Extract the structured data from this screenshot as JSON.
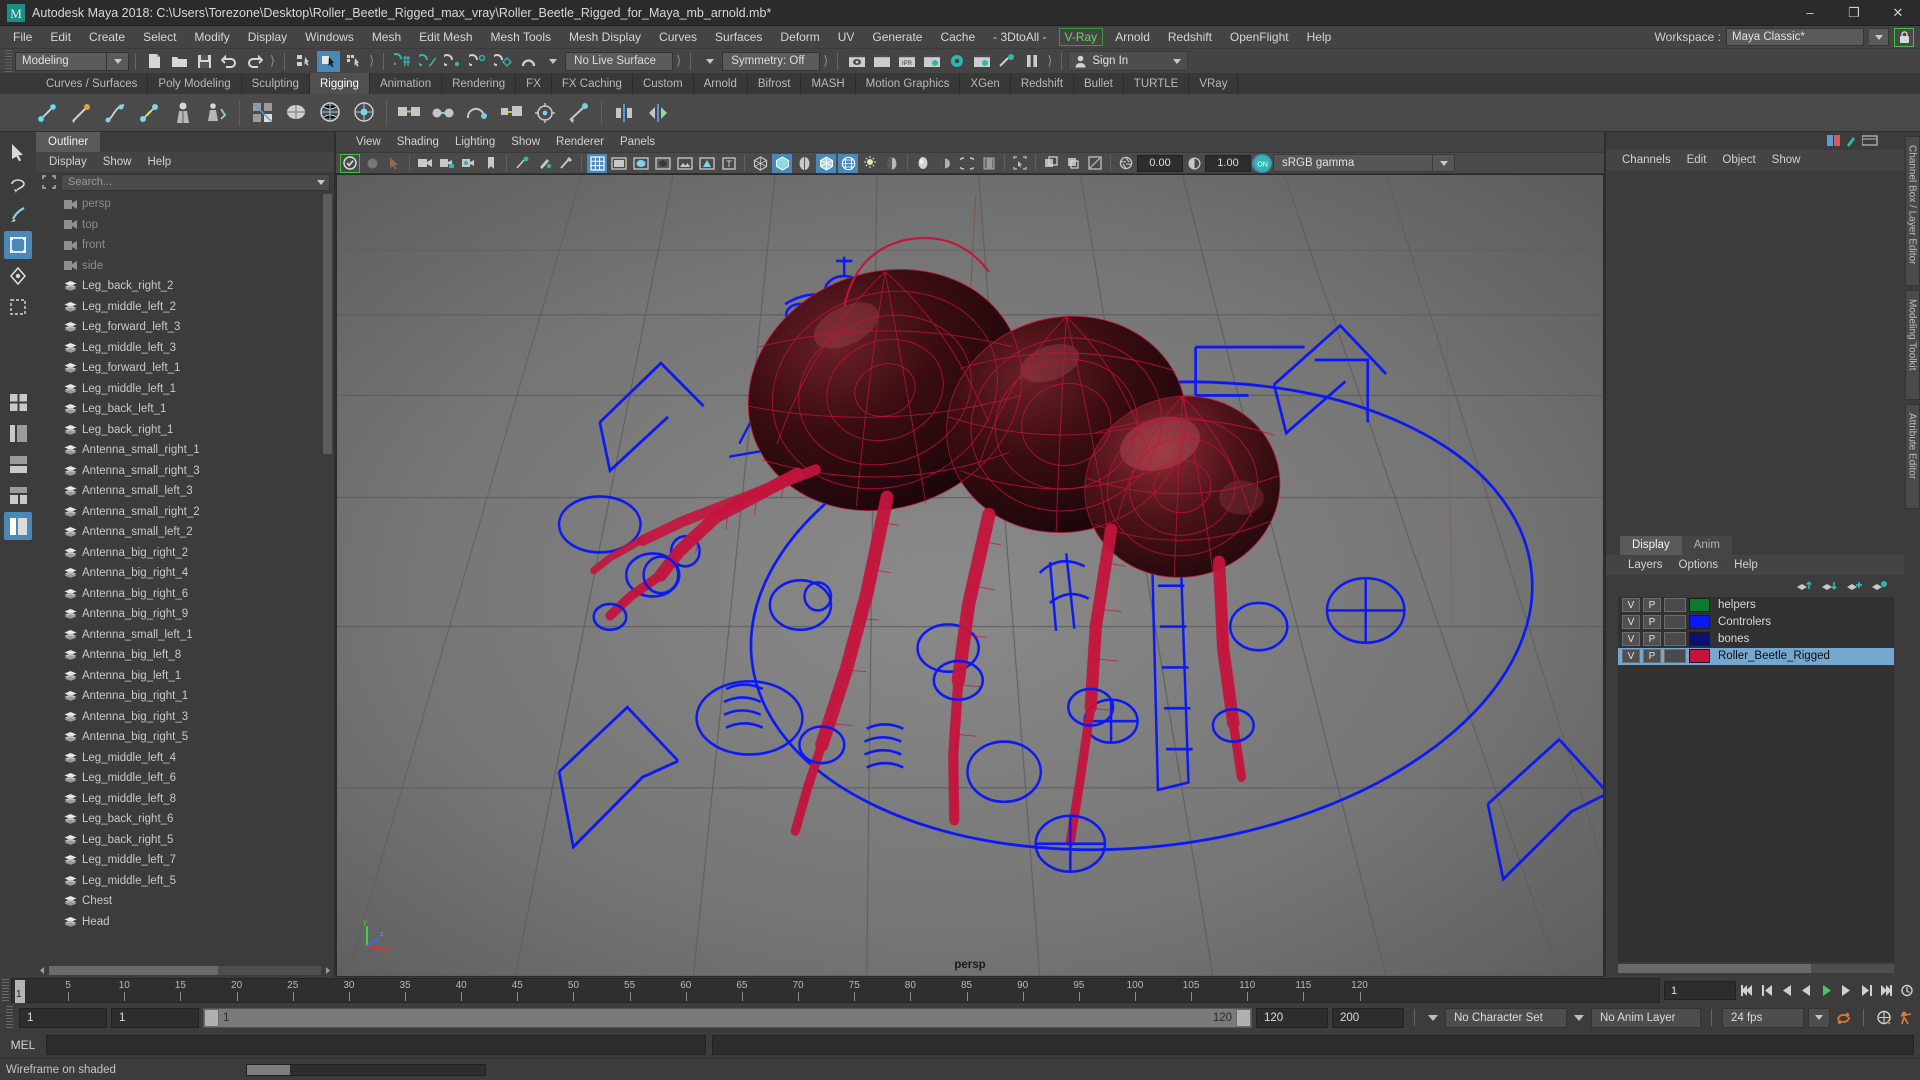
{
  "titlebar": {
    "title": "Autodesk Maya 2018: C:\\Users\\Torezone\\Desktop\\Roller_Beetle_Rigged_max_vray\\Roller_Beetle_Rigged_for_Maya_mb_arnold.mb*",
    "minimize": "–",
    "maximize": "❐",
    "close": "✕"
  },
  "menubar": {
    "items": [
      {
        "label": "File"
      },
      {
        "label": "Edit"
      },
      {
        "label": "Create"
      },
      {
        "label": "Select"
      },
      {
        "label": "Modify"
      },
      {
        "label": "Display"
      },
      {
        "label": "Windows"
      },
      {
        "label": "Mesh"
      },
      {
        "label": "Edit Mesh"
      },
      {
        "label": "Mesh Tools"
      },
      {
        "label": "Mesh Display"
      },
      {
        "label": "Curves"
      },
      {
        "label": "Surfaces"
      },
      {
        "label": "Deform"
      },
      {
        "label": "UV"
      },
      {
        "label": "Generate"
      },
      {
        "label": "Cache"
      },
      {
        "label": "- 3DtoAll -"
      },
      {
        "label": "V-Ray",
        "highlight": true
      },
      {
        "label": "Arnold"
      },
      {
        "label": "Redshift"
      },
      {
        "label": "OpenFlight"
      },
      {
        "label": "Help"
      }
    ],
    "workspace_label": "Workspace :",
    "workspace_value": "Maya Classic*",
    "lock_icon": "lock-icon"
  },
  "statusline": {
    "mode": "Modeling",
    "live_surface": "No Live Surface",
    "symmetry": "Symmetry: Off",
    "signin": "Sign In"
  },
  "shelf": {
    "tabs": [
      {
        "label": "Curves / Surfaces"
      },
      {
        "label": "Poly Modeling"
      },
      {
        "label": "Sculpting"
      },
      {
        "label": "Rigging",
        "active": true
      },
      {
        "label": "Animation"
      },
      {
        "label": "Rendering"
      },
      {
        "label": "FX"
      },
      {
        "label": "FX Caching"
      },
      {
        "label": "Custom"
      },
      {
        "label": "Arnold"
      },
      {
        "label": "Bifrost"
      },
      {
        "label": "MASH"
      },
      {
        "label": "Motion Graphics"
      },
      {
        "label": "XGen"
      },
      {
        "label": "Redshift"
      },
      {
        "label": "Bullet"
      },
      {
        "label": "TURTLE"
      },
      {
        "label": "VRay"
      }
    ]
  },
  "outliner": {
    "tab": "Outliner",
    "menus": [
      "Display",
      "Show",
      "Help"
    ],
    "search_placeholder": "Search...",
    "items": [
      {
        "label": "persp",
        "icon": "camera-icon",
        "dim": true
      },
      {
        "label": "top",
        "icon": "camera-icon",
        "dim": true
      },
      {
        "label": "front",
        "icon": "camera-icon",
        "dim": true
      },
      {
        "label": "side",
        "icon": "camera-icon",
        "dim": true
      },
      {
        "label": "Leg_back_right_2",
        "icon": "mesh-icon"
      },
      {
        "label": "Leg_middle_left_2",
        "icon": "mesh-icon"
      },
      {
        "label": "Leg_forward_left_3",
        "icon": "mesh-icon"
      },
      {
        "label": "Leg_middle_left_3",
        "icon": "mesh-icon"
      },
      {
        "label": "Leg_forward_left_1",
        "icon": "mesh-icon"
      },
      {
        "label": "Leg_middle_left_1",
        "icon": "mesh-icon"
      },
      {
        "label": "Leg_back_left_1",
        "icon": "mesh-icon"
      },
      {
        "label": "Leg_back_right_1",
        "icon": "mesh-icon"
      },
      {
        "label": "Antenna_small_right_1",
        "icon": "mesh-icon"
      },
      {
        "label": "Antenna_small_right_3",
        "icon": "mesh-icon"
      },
      {
        "label": "Antenna_small_left_3",
        "icon": "mesh-icon"
      },
      {
        "label": "Antenna_small_right_2",
        "icon": "mesh-icon"
      },
      {
        "label": "Antenna_small_left_2",
        "icon": "mesh-icon"
      },
      {
        "label": "Antenna_big_right_2",
        "icon": "mesh-icon"
      },
      {
        "label": "Antenna_big_right_4",
        "icon": "mesh-icon"
      },
      {
        "label": "Antenna_big_right_6",
        "icon": "mesh-icon"
      },
      {
        "label": "Antenna_big_right_9",
        "icon": "mesh-icon"
      },
      {
        "label": "Antenna_small_left_1",
        "icon": "mesh-icon"
      },
      {
        "label": "Antenna_big_left_8",
        "icon": "mesh-icon"
      },
      {
        "label": "Antenna_big_left_1",
        "icon": "mesh-icon"
      },
      {
        "label": "Antenna_big_right_1",
        "icon": "mesh-icon"
      },
      {
        "label": "Antenna_big_right_3",
        "icon": "mesh-icon"
      },
      {
        "label": "Antenna_big_right_5",
        "icon": "mesh-icon"
      },
      {
        "label": "Leg_middle_left_4",
        "icon": "mesh-icon"
      },
      {
        "label": "Leg_middle_left_6",
        "icon": "mesh-icon"
      },
      {
        "label": "Leg_middle_left_8",
        "icon": "mesh-icon"
      },
      {
        "label": "Leg_back_right_6",
        "icon": "mesh-icon"
      },
      {
        "label": "Leg_back_right_5",
        "icon": "mesh-icon"
      },
      {
        "label": "Leg_middle_left_7",
        "icon": "mesh-icon"
      },
      {
        "label": "Leg_middle_left_5",
        "icon": "mesh-icon"
      },
      {
        "label": "Chest",
        "icon": "mesh-icon"
      },
      {
        "label": "Head",
        "icon": "mesh-icon"
      }
    ]
  },
  "viewport": {
    "menus": [
      "View",
      "Shading",
      "Lighting",
      "Show",
      "Renderer",
      "Panels"
    ],
    "exposure": "0.00",
    "gamma_value": "1.00",
    "color_space": "sRGB gamma",
    "camera_label": "persp",
    "axis": {
      "x": "x",
      "y": "y",
      "z": "z"
    }
  },
  "channelbox": {
    "menus": [
      "Channels",
      "Edit",
      "Object",
      "Show"
    ]
  },
  "layers": {
    "tabs": [
      {
        "label": "Display",
        "active": true
      },
      {
        "label": "Anim",
        "active": false
      }
    ],
    "menus": [
      "Layers",
      "Options",
      "Help"
    ],
    "rows": [
      {
        "v": "V",
        "p": "P",
        "color": "#0b7a2a",
        "name": "helpers",
        "selected": false
      },
      {
        "v": "V",
        "p": "P",
        "color": "#0b18f5",
        "name": "Controlers",
        "selected": false
      },
      {
        "v": "V",
        "p": "P",
        "color": "#0a1170",
        "name": "bones",
        "selected": false
      },
      {
        "v": "V",
        "p": "P",
        "color": "#c4143c",
        "name": "Roller_Beetle_Rigged",
        "selected": true
      }
    ]
  },
  "right_tabs": [
    {
      "label": "Channel Box / Layer Editor"
    },
    {
      "label": "Modeling Toolkit"
    },
    {
      "label": "Attribute Editor"
    }
  ],
  "timeline": {
    "current_frame_label": "1",
    "ticks": [
      5,
      10,
      15,
      20,
      25,
      30,
      35,
      40,
      45,
      50,
      55,
      60,
      65,
      70,
      75,
      80,
      85,
      90,
      95,
      100,
      105,
      110,
      115,
      120
    ],
    "frame_field": "1"
  },
  "rangebar": {
    "start_field": "1",
    "range_start": "1",
    "slider_left": "1",
    "slider_right": "120",
    "range_end": "120",
    "end_field": "200",
    "character_set": "No Character Set",
    "anim_layer": "No Anim Layer",
    "fps": "24 fps"
  },
  "commandline": {
    "label": "MEL",
    "input_value": "",
    "output_value": ""
  },
  "helpline": {
    "text": "Wireframe on shaded"
  },
  "colors": {
    "accent_blue": "#4a88b8",
    "vray_green": "#64d864",
    "wire_red": "#c4143c",
    "controller_blue": "#0b18f5",
    "viewport_bg": "#6e6e6e"
  }
}
